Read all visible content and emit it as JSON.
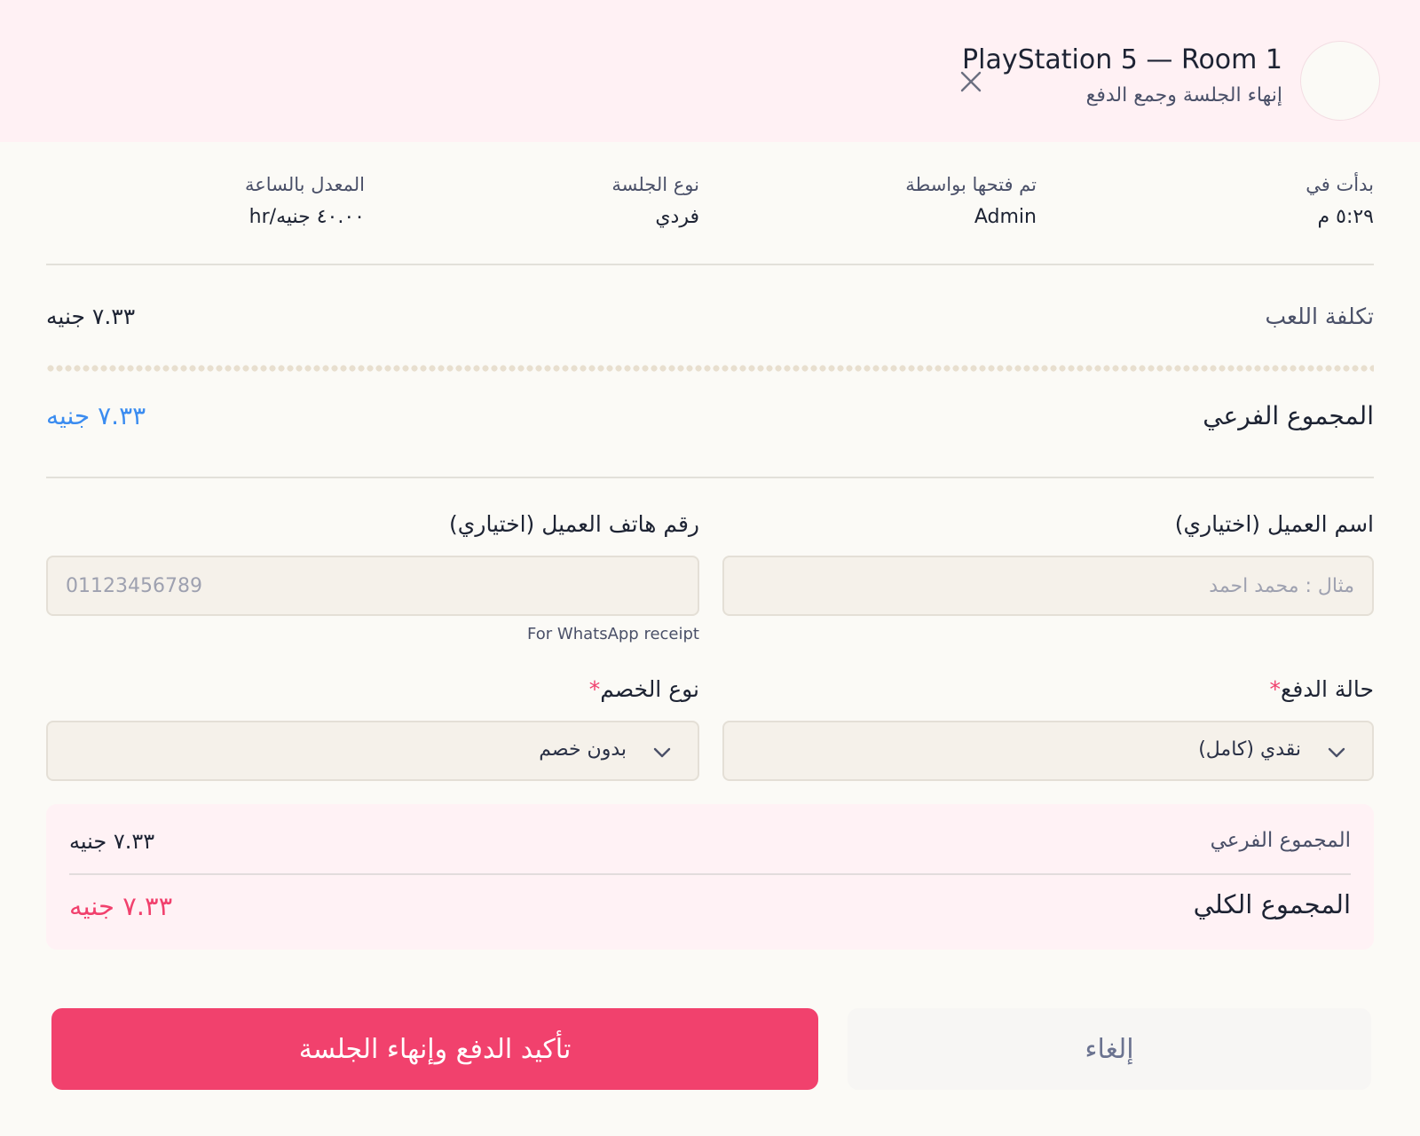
{
  "header": {
    "title": "PlayStation 5 — Room 1",
    "subtitle": "إنهاء الجلسة وجمع الدفع"
  },
  "info": [
    {
      "label": "بدأت في",
      "value": "٥:٢٩ م"
    },
    {
      "label": "تم فتحها بواسطة",
      "value": "Admin"
    },
    {
      "label": "نوع الجلسة",
      "value": "فردي"
    },
    {
      "label": "المعدل بالساعة",
      "value": "٤٠.٠٠ جنيه/hr"
    }
  ],
  "play_cost": {
    "label": "تكلفة اللعب",
    "value": "٧.٣٣ جنيه"
  },
  "subtotal": {
    "label": "المجموع الفرعي",
    "value": "٧.٣٣ جنيه"
  },
  "form": {
    "customer_name": {
      "label": "اسم العميل (اختياري)",
      "placeholder": "مثال : محمد احمد",
      "value": ""
    },
    "customer_phone": {
      "label": "رقم هاتف العميل (اختياري)",
      "placeholder": "01123456789",
      "value": "",
      "helper": "For WhatsApp receipt"
    },
    "payment_status": {
      "label": "حالة الدفع",
      "required_mark": "*",
      "selected": "نقدي (كامل)"
    },
    "discount_type": {
      "label": "نوع الخصم",
      "required_mark": "*",
      "selected": "بدون خصم"
    }
  },
  "summary": {
    "subtotal_label": "المجموع الفرعي",
    "subtotal_value": "٧.٣٣ جنيه",
    "total_label": "المجموع الكلي",
    "total_value": "٧.٣٣ جنيه"
  },
  "buttons": {
    "confirm": "تأكيد الدفع وإنهاء الجلسة",
    "cancel": "إلغاء"
  },
  "colors": {
    "accent": "#f1416d",
    "link_blue": "#3b8cf0",
    "header_bg": "#fff1f4",
    "page_bg": "#fbfaf6"
  },
  "icons": {
    "close": "close-icon",
    "chevron": "chevron-down-icon"
  }
}
